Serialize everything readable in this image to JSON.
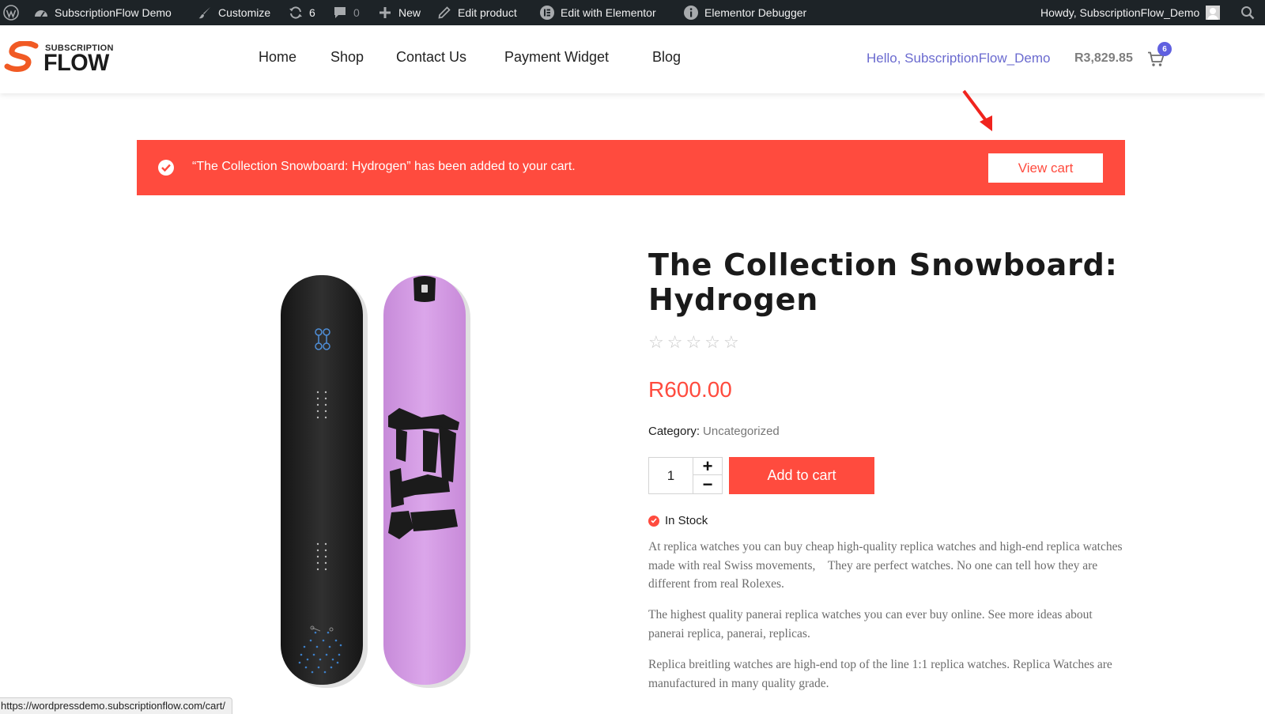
{
  "admin_bar": {
    "site_name": "SubscriptionFlow Demo",
    "customize": "Customize",
    "updates_count": "6",
    "comments_count": "0",
    "new_label": "New",
    "edit_product": "Edit product",
    "edit_elementor": "Edit with Elementor",
    "elementor_debugger": "Elementor Debugger",
    "howdy": "Howdy, SubscriptionFlow_Demo"
  },
  "header": {
    "logo_top": "SUBSCRIPTION",
    "logo_main": "FLOW",
    "nav": [
      "Home",
      "Shop",
      "Contact Us",
      "Payment Widget",
      "Blog"
    ],
    "greeting": "Hello, SubscriptionFlow_Demo",
    "cart_total": "R3,829.85",
    "cart_count": "6"
  },
  "notice": {
    "message": "“The Collection Snowboard: Hydrogen” has been added to your cart.",
    "button": "View cart"
  },
  "product": {
    "title": "The Collection Snowboard: Hydrogen",
    "rating": 0,
    "rating_max": 5,
    "price": "R600.00",
    "category_label": "Category:",
    "category": "Uncategorized",
    "quantity": "1",
    "add_to_cart": "Add to cart",
    "stock": "In Stock",
    "description": [
      "At replica watches you can buy cheap high-quality replica watches and high-end replica watches made with real Swiss movements,　They are perfect watches. No one can tell how they are different from real Rolexes.",
      "The highest quality panerai replica watches you can ever buy online. See more ideas about panerai replica, panerai, replicas.",
      "Replica breitling watches are high-end top of the line 1:1 replica watches. Replica Watches are manufactured in many quality grade."
    ]
  },
  "status_url": "https://wordpressdemo.subscriptionflow.com/cart/",
  "colors": {
    "accent": "#ff4b3e",
    "admin_bar": "#1d2327",
    "greeting": "#6a6acf",
    "cart_badge": "#6060e0",
    "board_dark": "#262626",
    "board_purple": "#d49ce4"
  },
  "icons": [
    "wordpress-icon",
    "dashboard-icon",
    "brush-icon",
    "updates-icon",
    "comment-icon",
    "plus-icon",
    "pencil-icon",
    "elementor-icon",
    "info-icon",
    "search-icon",
    "cart-icon",
    "check-icon",
    "arrow-icon"
  ]
}
